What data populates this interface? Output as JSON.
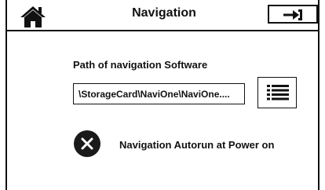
{
  "header": {
    "title": "Navigation",
    "home_icon": "home-icon",
    "exit_icon": "exit-arrow-icon"
  },
  "path": {
    "label": "Path of navigation Software",
    "value": "\\StorageCard\\NaviOne\\NaviOne....",
    "browse_icon": "list-icon"
  },
  "autorun": {
    "label": "Navigation Autorun at Power on",
    "state": "off",
    "icon": "close-icon"
  },
  "colors": {
    "foreground": "#111111",
    "background": "#ffffff",
    "toggle_fill": "#1a1a1a"
  }
}
